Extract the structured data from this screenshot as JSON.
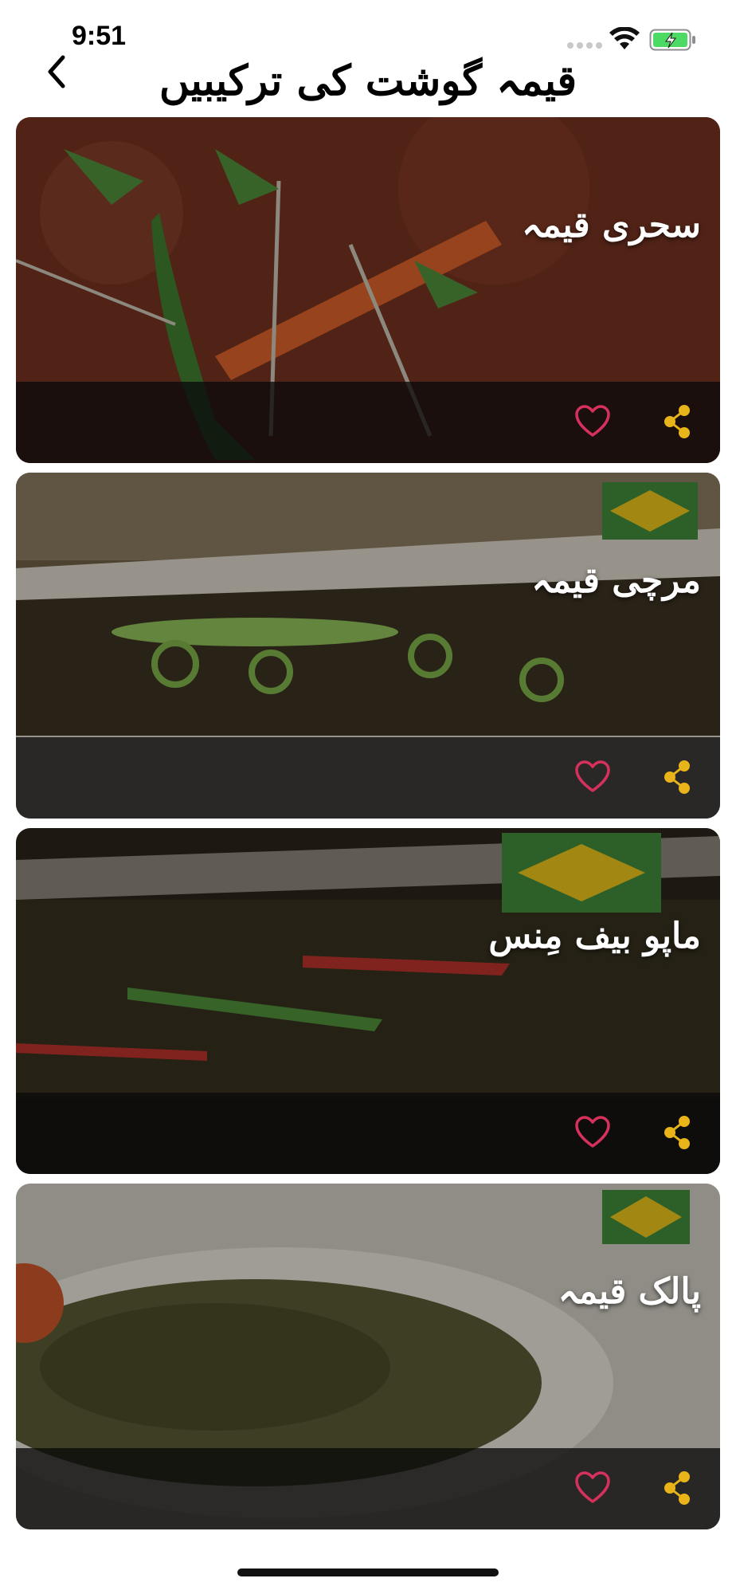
{
  "status_bar": {
    "time": "9:51",
    "battery_color": "#4cd964",
    "signal_color": "#c8c8c8"
  },
  "nav": {
    "back_icon": "chevron-left-icon",
    "title": "قیمہ گوشت کی ترکیبیں"
  },
  "recipes": [
    {
      "title": "سحری قیمہ",
      "image_tone": "#6b2c1d",
      "favorite_icon": "heart-outline-icon",
      "share_icon": "share-icon"
    },
    {
      "title": "مرچی قیمہ",
      "image_tone": "#4a3a22",
      "favorite_icon": "heart-outline-icon",
      "share_icon": "share-icon"
    },
    {
      "title": "ماپو بیف مِنس",
      "image_tone": "#1f1a12",
      "favorite_icon": "heart-outline-icon",
      "share_icon": "share-icon"
    },
    {
      "title": "پالک قیمہ",
      "image_tone": "#3a3a22",
      "favorite_icon": "heart-outline-icon",
      "share_icon": "share-icon"
    }
  ],
  "colors": {
    "favorite": "#d6315c",
    "share": "#e9b41a"
  }
}
